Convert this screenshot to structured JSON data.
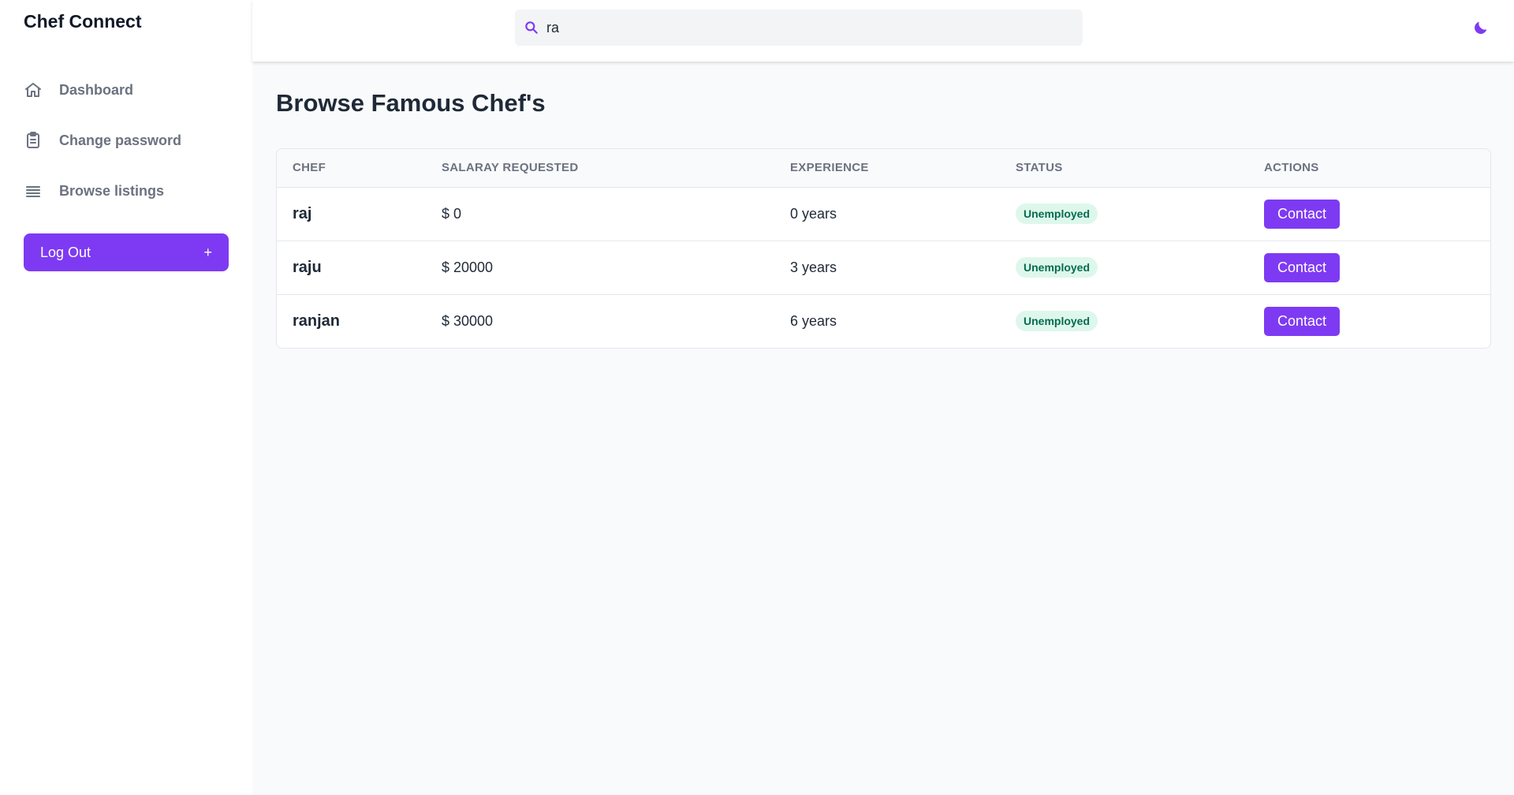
{
  "app": {
    "title": "Chef Connect"
  },
  "sidebar": {
    "items": [
      {
        "label": "Dashboard",
        "icon": "home-icon"
      },
      {
        "label": "Change password",
        "icon": "clipboard-icon"
      },
      {
        "label": "Browse listings",
        "icon": "list-icon"
      }
    ],
    "logout": {
      "label": "Log Out",
      "icon_text": "+"
    }
  },
  "header": {
    "search": {
      "value": "ra",
      "icon": "search-icon"
    },
    "theme_toggle_icon": "moon-icon"
  },
  "main": {
    "title": "Browse Famous Chef's",
    "table": {
      "columns": [
        "CHEF",
        "SALARAY REQUESTED",
        "EXPERIENCE",
        "STATUS",
        "ACTIONS"
      ],
      "rows": [
        {
          "chef": "raj",
          "salary": "$ 0",
          "experience": "0 years",
          "status": "Unemployed",
          "action": "Contact"
        },
        {
          "chef": "raju",
          "salary": "$ 20000",
          "experience": "3 years",
          "status": "Unemployed",
          "action": "Contact"
        },
        {
          "chef": "ranjan",
          "salary": "$ 30000",
          "experience": "6 years",
          "status": "Unemployed",
          "action": "Contact"
        }
      ]
    }
  },
  "colors": {
    "accent": "#7e3af2",
    "badge_bg": "#def7ec",
    "badge_text": "#046c4e"
  }
}
